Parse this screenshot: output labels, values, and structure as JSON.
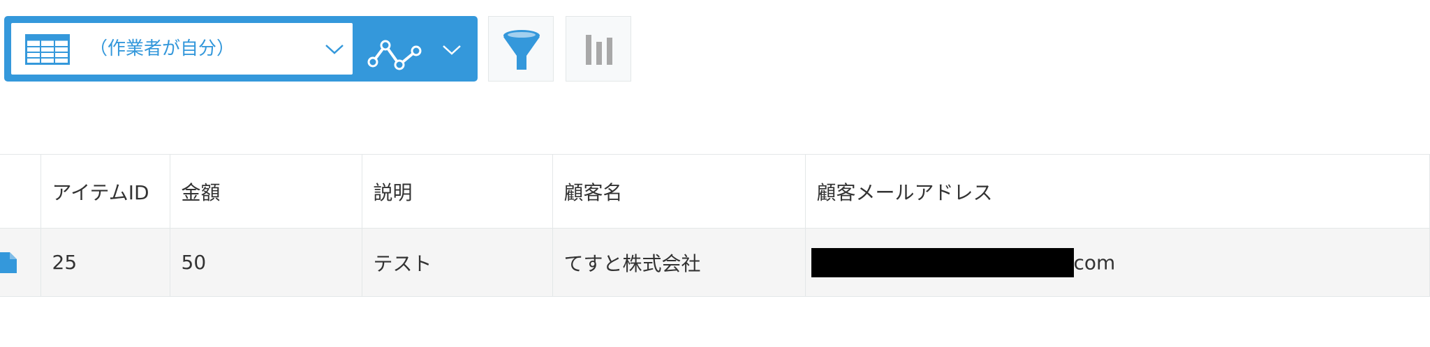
{
  "toolbar": {
    "view_name": "（作業者が自分）",
    "colors": {
      "accent": "#3498db",
      "filter_icon": "#3498db",
      "graph_icon": "#a8a8a8"
    },
    "icons": {
      "view": "table-icon",
      "view_dropdown": "chevron-down-icon",
      "graph_type": "line-graph-icon",
      "graph_dropdown": "chevron-down-icon",
      "filter": "filter-funnel-icon",
      "graph": "bar-chart-icon"
    }
  },
  "table": {
    "columns": [
      "アイテムID",
      "金額",
      "説明",
      "顧客名",
      "顧客メールアドレス"
    ],
    "rows": [
      {
        "item_id": "25",
        "amount": "50",
        "description": "テスト",
        "customer_name": "てすと株式会社",
        "customer_email_visible": "com",
        "row_icon": "document-icon"
      }
    ]
  }
}
